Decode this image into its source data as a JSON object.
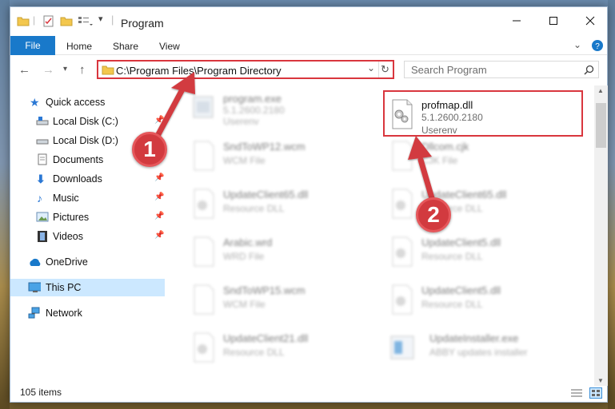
{
  "window": {
    "title": "Program"
  },
  "ribbon": {
    "tabs": [
      "File",
      "Home",
      "Share",
      "View"
    ]
  },
  "address": {
    "path": "C:\\Program Files\\Program Directory"
  },
  "search": {
    "placeholder": "Search Program"
  },
  "sidebar": {
    "items": [
      {
        "label": "Quick access",
        "icon": "star-icon"
      },
      {
        "label": "Local Disk (C:)",
        "icon": "drive-icon"
      },
      {
        "label": "Local Disk (D:)",
        "icon": "drive-icon"
      },
      {
        "label": "Documents",
        "icon": "documents-icon"
      },
      {
        "label": "Downloads",
        "icon": "download-icon"
      },
      {
        "label": "Music",
        "icon": "music-icon"
      },
      {
        "label": "Pictures",
        "icon": "pictures-icon"
      },
      {
        "label": "Videos",
        "icon": "videos-icon"
      },
      {
        "label": "OneDrive",
        "icon": "cloud-icon"
      },
      {
        "label": "This PC",
        "icon": "computer-icon"
      },
      {
        "label": "Network",
        "icon": "network-icon"
      }
    ]
  },
  "files": {
    "highlighted": {
      "name": "profmap.dll",
      "version": "5.1.2600.2180",
      "company": "Userenv"
    },
    "blurred": [
      {
        "name": "program.exe",
        "sub": "5.1.2600.2180",
        "sub2": "Userenv"
      },
      {
        "name": "SndToWP12.wcm",
        "sub": "WCM File"
      },
      {
        "name": "Dllcom.cjk",
        "sub": "CJK File"
      },
      {
        "name": "UpdateClient65.dll",
        "sub": "Resource DLL"
      },
      {
        "name": "UpdateClient65.dll",
        "sub": "Resource DLL"
      },
      {
        "name": "Arabic.wrd",
        "sub": "WRD File"
      },
      {
        "name": "UpdateClient5.dll",
        "sub": "Resource DLL"
      },
      {
        "name": "SndToWP15.wcm",
        "sub": "WCM File"
      },
      {
        "name": "UpdateClient5.dll",
        "sub": "Resource DLL"
      },
      {
        "name": "UpdateClient21.dll",
        "sub": "Resource DLL"
      },
      {
        "name": "UpdateInstaller.exe",
        "sub": "ABBY updates installer"
      }
    ]
  },
  "status": {
    "count": "105 items"
  },
  "annotations": {
    "step1": "1",
    "step2": "2"
  },
  "colors": {
    "accent": "#1979ca",
    "highlight": "#d9363e",
    "selected": "#cce8ff"
  }
}
